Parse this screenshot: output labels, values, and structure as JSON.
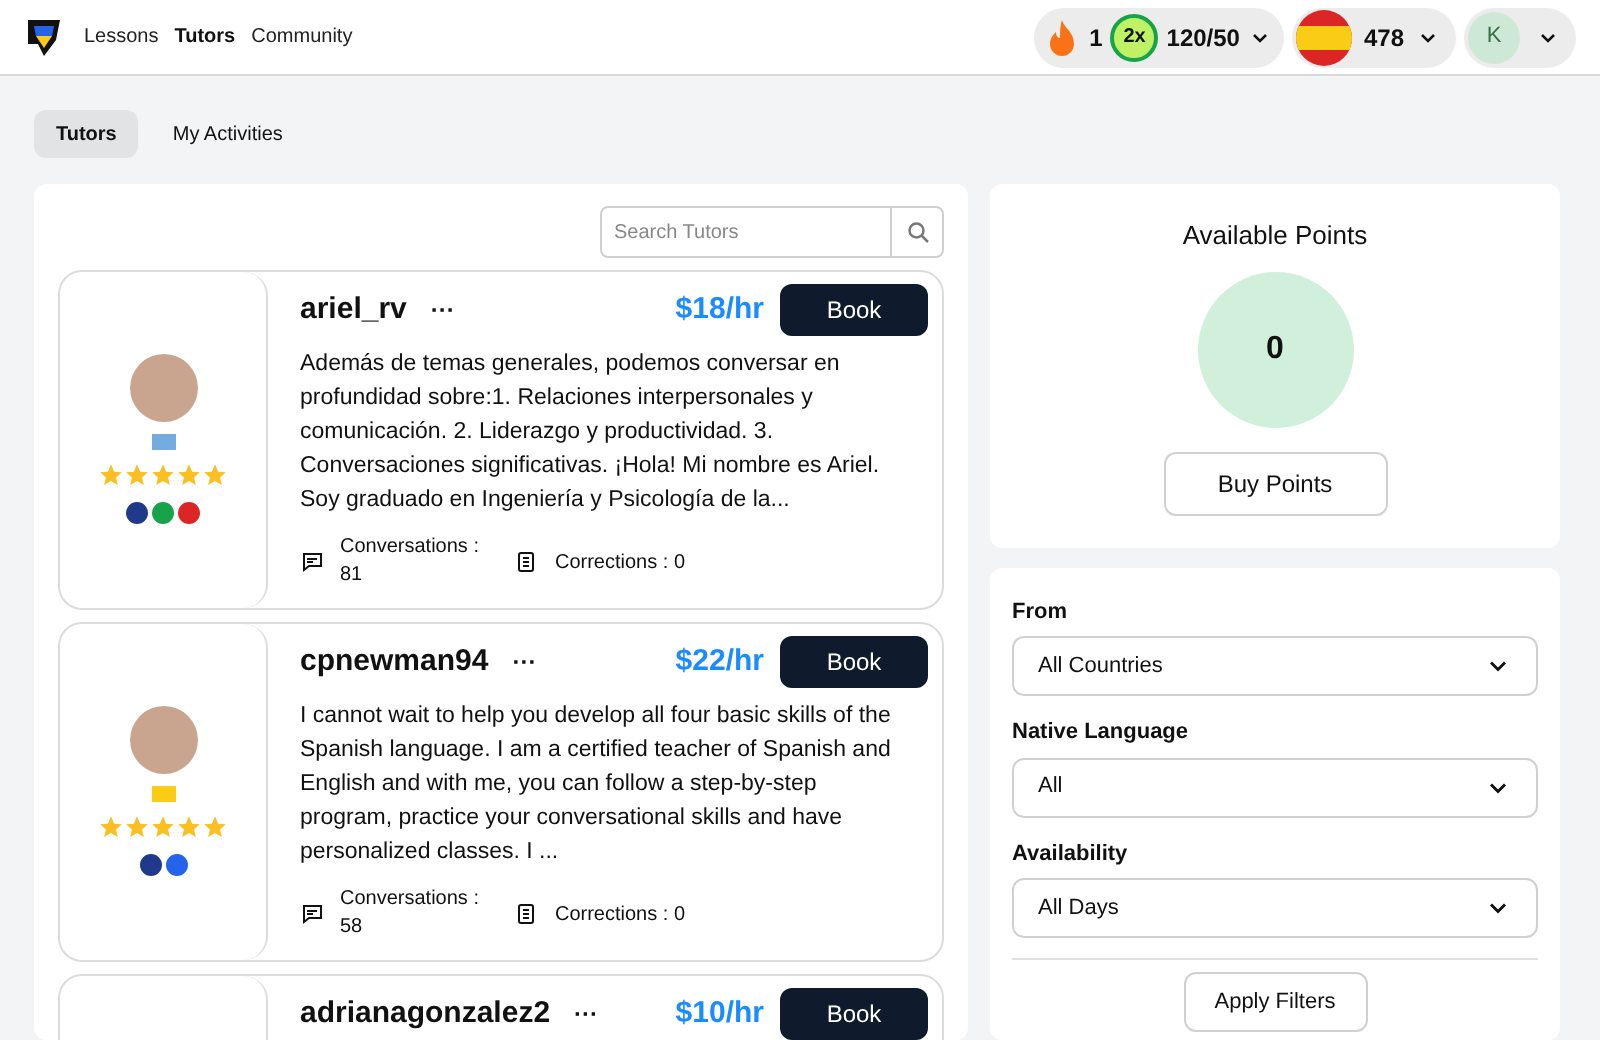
{
  "nav": {
    "links": [
      {
        "label": "Lessons",
        "selected": false
      },
      {
        "label": "Tutors",
        "selected": true
      },
      {
        "label": "Community",
        "selected": false
      }
    ]
  },
  "status": {
    "streak": "1",
    "multiplier": "2x",
    "progress": "120/50",
    "points": "478",
    "avatar_letter": "K"
  },
  "tabs": [
    {
      "label": "Tutors",
      "selected": true
    },
    {
      "label": "My Activities",
      "selected": false
    }
  ],
  "search": {
    "placeholder": "Search Tutors"
  },
  "tutors": [
    {
      "name": "ariel_rv",
      "more": "···",
      "price": "$18/hr",
      "button": "Book",
      "stars": 5,
      "country_flag": {
        "color": "#74acdf"
      },
      "languages": [
        {
          "color": "#1f3a8a"
        },
        {
          "color": "#16a34a"
        },
        {
          "color": "#dc2626"
        }
      ],
      "description": "Además de temas generales, podemos conversar en profundidad sobre:1. Relaciones interpersonales y comunicación. 2. Liderazgo y productividad. 3. Conversaciones significativas. ¡Hola! Mi nombre es Ariel. Soy graduado en Ingeniería y Psicología de la...",
      "conversations_label": "Conversations :",
      "conversations": "81",
      "corrections": "Corrections : 0"
    },
    {
      "name": "cpnewman94",
      "more": "···",
      "price": "$22/hr",
      "button": "Book",
      "stars": 5,
      "country_flag": {
        "color": "#facc15"
      },
      "languages": [
        {
          "color": "#1f3a8a"
        },
        {
          "color": "#2563eb"
        }
      ],
      "description": "I cannot wait to help you develop all four basic skills of the Spanish language. I am a certified teacher of Spanish and English and with me, you can follow a step-by-step program, practice your conversational skills and have personalized classes. I ...",
      "conversations_label": "Conversations :",
      "conversations": "58",
      "corrections": "Corrections : 0"
    },
    {
      "name": "adrianagonzalez2",
      "more": "···",
      "price": "$10/hr",
      "button": "Book"
    }
  ],
  "points": {
    "title": "Available Points",
    "value": "0",
    "button": "Buy Points"
  },
  "filters": [
    {
      "label": "From",
      "value": "All Countries"
    },
    {
      "label": "Native Language",
      "value": "All"
    },
    {
      "label": "Availability",
      "value": "All Days"
    }
  ],
  "apply_button": "Apply Filters"
}
